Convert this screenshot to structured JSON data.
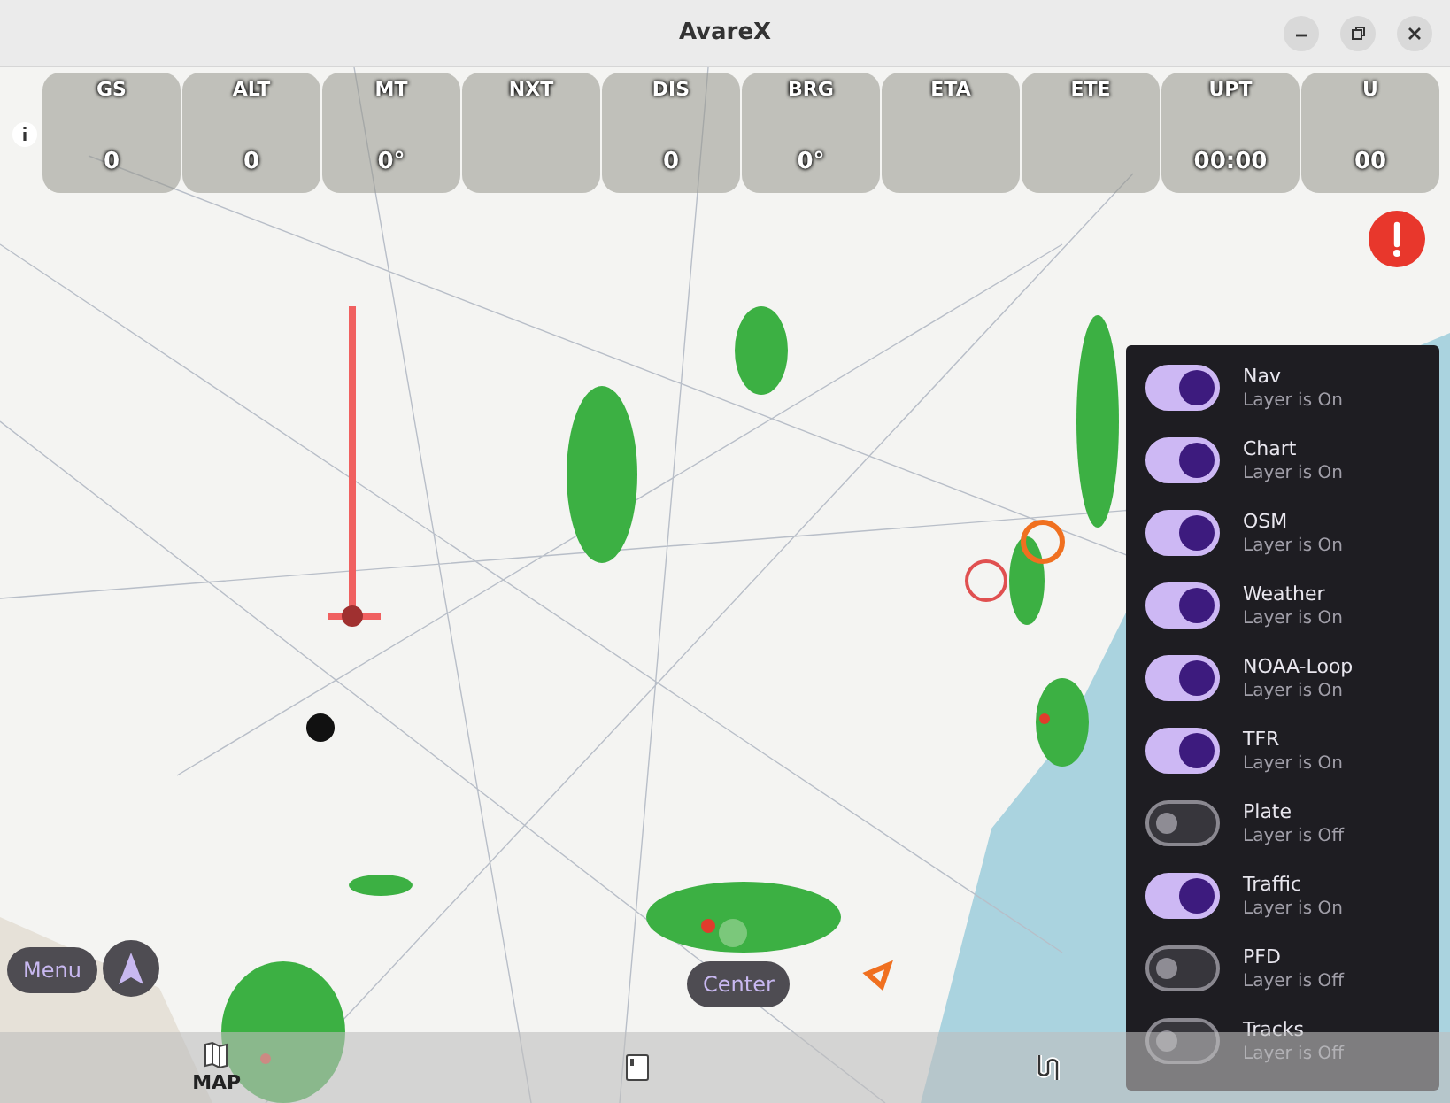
{
  "window": {
    "title": "AvareX"
  },
  "instruments": [
    {
      "label": "GS",
      "value": "0"
    },
    {
      "label": "ALT",
      "value": "0"
    },
    {
      "label": "MT",
      "value": "0°"
    },
    {
      "label": "NXT"
    },
    {
      "label": "DIS",
      "value": "0"
    },
    {
      "label": "BRG",
      "value": "0°"
    },
    {
      "label": "ETA"
    },
    {
      "label": "ETE"
    },
    {
      "label": "UPT",
      "value": "00:00"
    },
    {
      "label": "U",
      "value": "00"
    }
  ],
  "layers": [
    {
      "name": "Nav",
      "status": "Layer is On",
      "on": true
    },
    {
      "name": "Chart",
      "status": "Layer is On",
      "on": true
    },
    {
      "name": "OSM",
      "status": "Layer is On",
      "on": true
    },
    {
      "name": "Weather",
      "status": "Layer is On",
      "on": true
    },
    {
      "name": "NOAA-Loop",
      "status": "Layer is On",
      "on": true
    },
    {
      "name": "TFR",
      "status": "Layer is On",
      "on": true
    },
    {
      "name": "Plate",
      "status": "Layer is Off",
      "on": false
    },
    {
      "name": "Traffic",
      "status": "Layer is On",
      "on": true
    },
    {
      "name": "PFD",
      "status": "Layer is Off",
      "on": false
    },
    {
      "name": "Tracks",
      "status": "Layer is Off",
      "on": false
    }
  ],
  "buttons": {
    "menu": "Menu",
    "center": "Center"
  },
  "bottom_tabs": [
    {
      "kind": "map",
      "label": "MAP"
    },
    {
      "kind": "document"
    },
    {
      "kind": "route"
    }
  ]
}
